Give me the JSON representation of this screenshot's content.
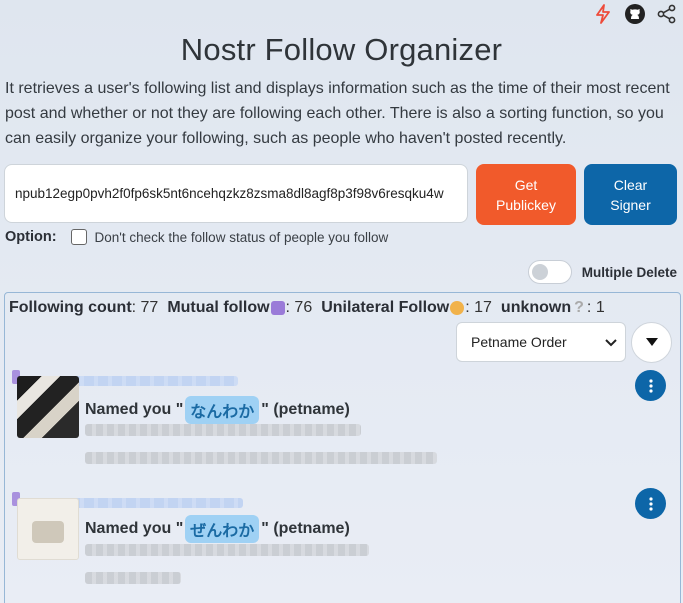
{
  "header": {
    "title": "Nostr Follow Organizer",
    "description": "It retrieves a user's following list and displays information such as the time of their most recent post and whether or not they are following each other. There is also a sorting function, so you can easily organize your following, such as people who haven't posted recently."
  },
  "top_icons": [
    "lightning-icon",
    "github-icon",
    "share-icon"
  ],
  "input": {
    "value": "npub12egp0pvh2f0fp6sk5nt6ncehqzkz8zsma8dl8agf8p3f98v6resqku4w"
  },
  "buttons": {
    "get_publickey": "Get Publickey",
    "clear_signer": "Clear Signer"
  },
  "option": {
    "label": "Option:",
    "checkbox_text": "Don't check the follow status of people you follow"
  },
  "multiple_delete": {
    "label": "Multiple Delete"
  },
  "stats": {
    "following_label": "Following count",
    "following_value": ": 77",
    "mutual_label": "Mutual follow",
    "mutual_value": ": 76",
    "unilateral_label": "Unilateral Follow",
    "unilateral_value": ": 17",
    "unknown_label": "unknown",
    "unknown_value": ": 1"
  },
  "sort": {
    "selected": "Petname Order"
  },
  "cards": [
    {
      "named_prefix": "Named you \"",
      "petname": "なんわか",
      "named_suffix": "\" (petname)"
    },
    {
      "named_prefix": "Named you \"",
      "petname": "ぜんわか",
      "named_suffix": "\" (petname)"
    }
  ],
  "colors": {
    "orange": "#f15a2b",
    "blue": "#0d66a8",
    "chip_bg": "#9fd1f4",
    "chip_text": "#1a6aa3",
    "mutual_emoji": "#9a7bd8",
    "unilateral_emoji": "#f1b24a"
  }
}
